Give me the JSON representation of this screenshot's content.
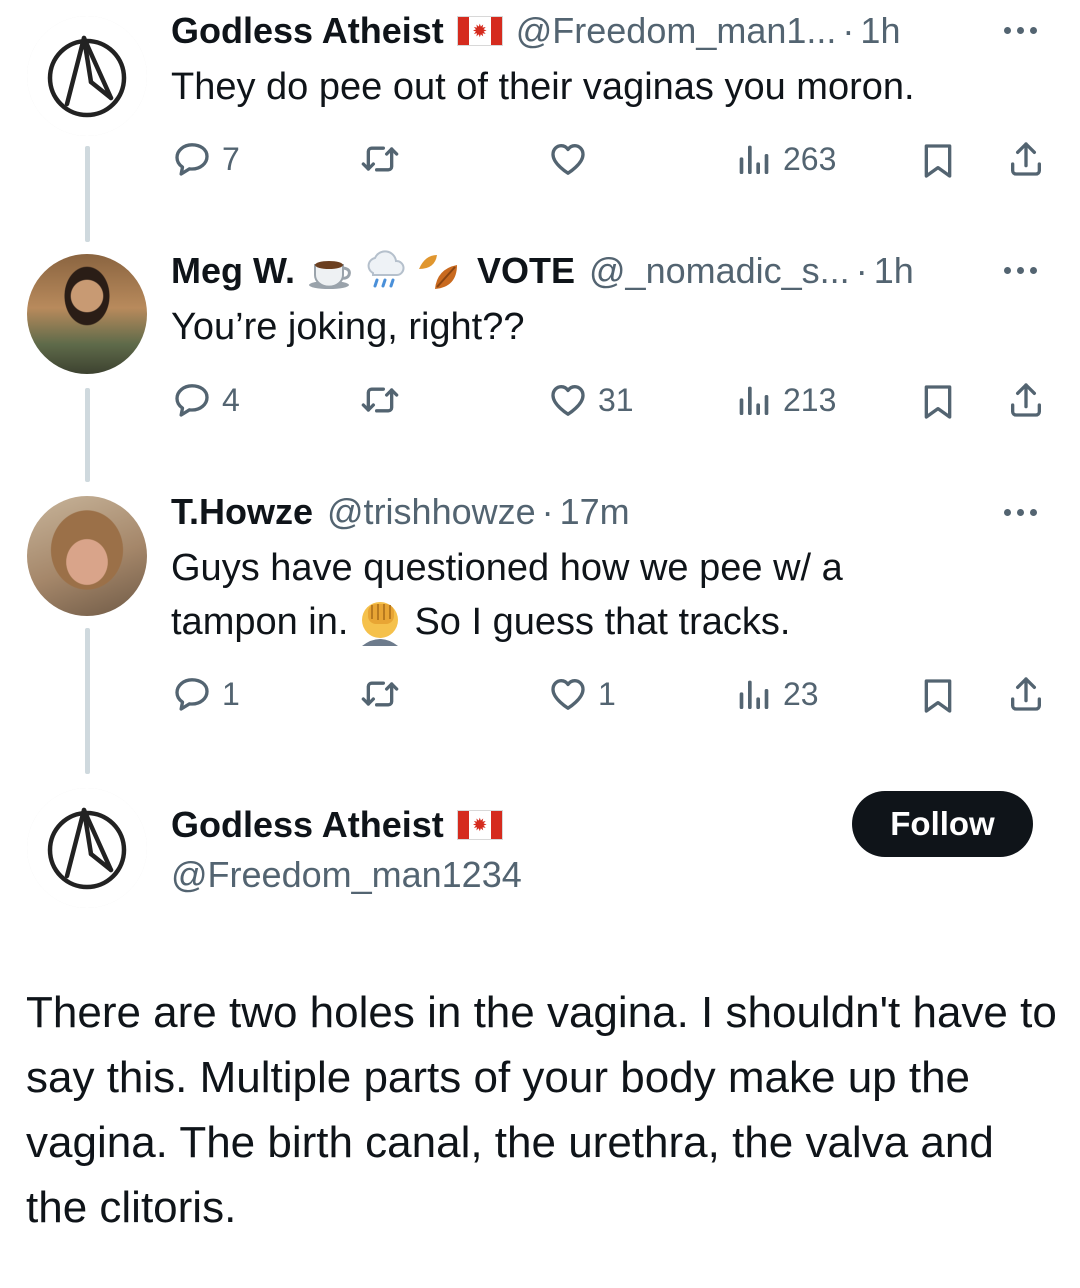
{
  "replies": [
    {
      "name": "Godless Atheist",
      "handle": "@Freedom_man1...",
      "time": "1h",
      "text": "They do pee out of their vaginas you moron.",
      "replies": "7",
      "likes": "",
      "views": "263"
    },
    {
      "name": "Meg W.",
      "name_suffix": "VOTE",
      "handle": "@_nomadic_s...",
      "time": "1h",
      "text": "You’re joking, right??",
      "replies": "4",
      "likes": "31",
      "views": "213"
    },
    {
      "name": "T.Howze",
      "handle": "@trishhowze",
      "time": "17m",
      "text_line1": "Guys have questioned how we pee w/ a",
      "text_line2a": "tampon in.",
      "text_line2b": "So I guess that tracks.",
      "replies": "1",
      "likes": "1",
      "views": "23"
    }
  ],
  "main_tweet": {
    "name": "Godless Atheist",
    "handle": "@Freedom_man1234",
    "follow_label": "Follow",
    "text": "There are two holes in the vagina. I shouldn't have to say this. Multiple parts of your body make up the vagina. The birth canal, the urethra, the valva and the clitoris."
  },
  "separator": "·",
  "icons": [
    "atheist-a-logo",
    "canada-flag-icon",
    "coffee-emoji",
    "rain-cloud-emoji",
    "falling-leaves-emoji",
    "facepalm-emoji",
    "more-icon",
    "reply-icon",
    "retweet-icon",
    "like-icon",
    "views-icon",
    "bookmark-icon",
    "share-icon"
  ],
  "colors": {
    "text": "#0f1419",
    "secondary": "#536471",
    "thread_line": "#cfd9de",
    "follow_bg": "#0f1419",
    "flag_red": "#d52b1e"
  }
}
